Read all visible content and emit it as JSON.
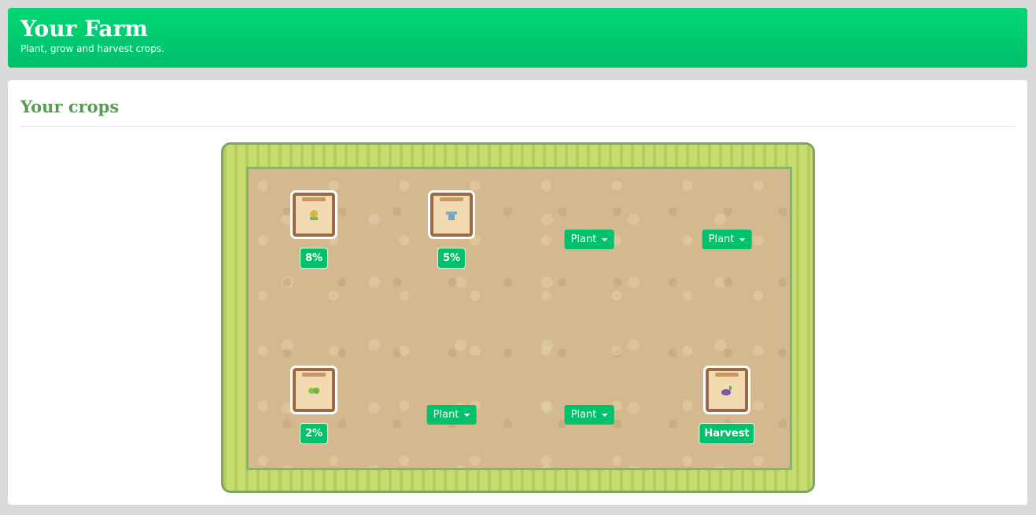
{
  "header": {
    "title": "Your Farm",
    "subtitle": "Plant, grow and harvest crops."
  },
  "crops_panel": {
    "title": "Your crops"
  },
  "plots": [
    {
      "state": "growing",
      "icon": "corn-seed-packet-icon",
      "label": "8%",
      "progress": 0.08,
      "color": "#c9b34a"
    },
    {
      "state": "growing",
      "icon": "watering-can-seed-packet-icon",
      "label": "5%",
      "progress": 0.05,
      "color": "#6ea3c4"
    },
    {
      "state": "empty",
      "label": "Plant"
    },
    {
      "state": "empty",
      "label": "Plant"
    },
    {
      "state": "growing",
      "icon": "green-bean-seed-packet-icon",
      "label": "2%",
      "progress": 0.02,
      "color": "#8cc24a"
    },
    {
      "state": "empty",
      "label": "Plant"
    },
    {
      "state": "empty",
      "label": "Plant"
    },
    {
      "state": "ready",
      "icon": "eggplant-seed-packet-icon",
      "label": "Harvest",
      "color": "#7a5aa8"
    }
  ],
  "colors": {
    "accent": "#00c26b",
    "heading": "#5a9a55"
  }
}
